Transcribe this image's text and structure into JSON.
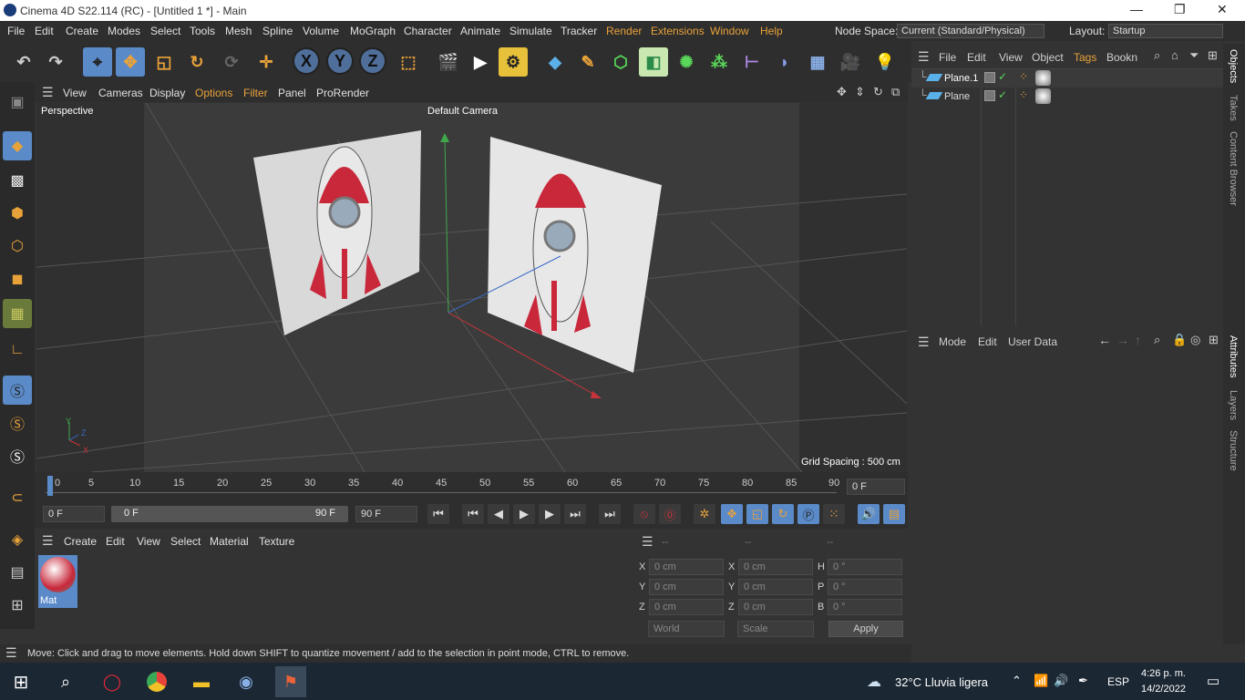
{
  "window": {
    "title": "Cinema 4D S22.114 (RC) - [Untitled 1 *] - Main"
  },
  "menu": [
    "File",
    "Edit",
    "Create",
    "Modes",
    "Select",
    "Tools",
    "Mesh",
    "Spline",
    "Volume",
    "MoGraph",
    "Character",
    "Animate",
    "Simulate",
    "Tracker",
    "Render",
    "Extensions",
    "Window",
    "Help"
  ],
  "node_space": {
    "label": "Node Space:",
    "value": "Current (Standard/Physical)"
  },
  "layout": {
    "label": "Layout:",
    "value": "Startup"
  },
  "viewport_menu": [
    "View",
    "Cameras",
    "Display",
    "Options",
    "Filter",
    "Panel",
    "ProRender"
  ],
  "viewport": {
    "view_name": "Perspective",
    "camera": "Default Camera",
    "grid_spacing": "Grid Spacing : 500 cm",
    "axis_x": "X",
    "axis_y": "Y",
    "axis_z": "Z"
  },
  "timeline": {
    "ticks": [
      "0",
      "5",
      "10",
      "15",
      "20",
      "25",
      "30",
      "35",
      "40",
      "45",
      "50",
      "55",
      "60",
      "65",
      "70",
      "75",
      "80",
      "85",
      "90"
    ],
    "current_frame": "0 F"
  },
  "transport": {
    "start": "0 F",
    "range_start": "0 F",
    "range_end": "90 F",
    "end": "90 F"
  },
  "material_menu": [
    "Create",
    "Edit",
    "View",
    "Select",
    "Material",
    "Texture"
  ],
  "material": {
    "name": "Mat"
  },
  "coords": {
    "headers": [
      "--",
      "--",
      "--"
    ],
    "rows": [
      {
        "a": "X",
        "av": "0 cm",
        "b": "X",
        "bv": "0 cm",
        "c": "H",
        "cv": "0 °"
      },
      {
        "a": "Y",
        "av": "0 cm",
        "b": "Y",
        "bv": "0 cm",
        "c": "P",
        "cv": "0 °"
      },
      {
        "a": "Z",
        "av": "0 cm",
        "b": "Z",
        "bv": "0 cm",
        "c": "B",
        "cv": "0 °"
      }
    ],
    "world": "World",
    "scale": "Scale",
    "apply": "Apply"
  },
  "object_menu": [
    "File",
    "Edit",
    "View",
    "Object",
    "Tags",
    "Bookn"
  ],
  "objects": [
    {
      "name": "Plane.1"
    },
    {
      "name": "Plane"
    }
  ],
  "attr_menu": [
    "Mode",
    "Edit",
    "User Data"
  ],
  "side_tabs": [
    "Objects",
    "Takes",
    "Content Browser",
    "Attributes",
    "Layers",
    "Structure"
  ],
  "status": "Move: Click and drag to move elements. Hold down SHIFT to quantize movement / add to the selection in point mode, CTRL to remove.",
  "taskbar": {
    "weather": "32°C  Lluvia ligera",
    "lang": "ESP",
    "time": "4:26 p. m.",
    "date": "14/2/2022"
  },
  "colors": {
    "accent": "#e8a23a",
    "selection": "#5a8ac8",
    "bg": "#333333"
  }
}
